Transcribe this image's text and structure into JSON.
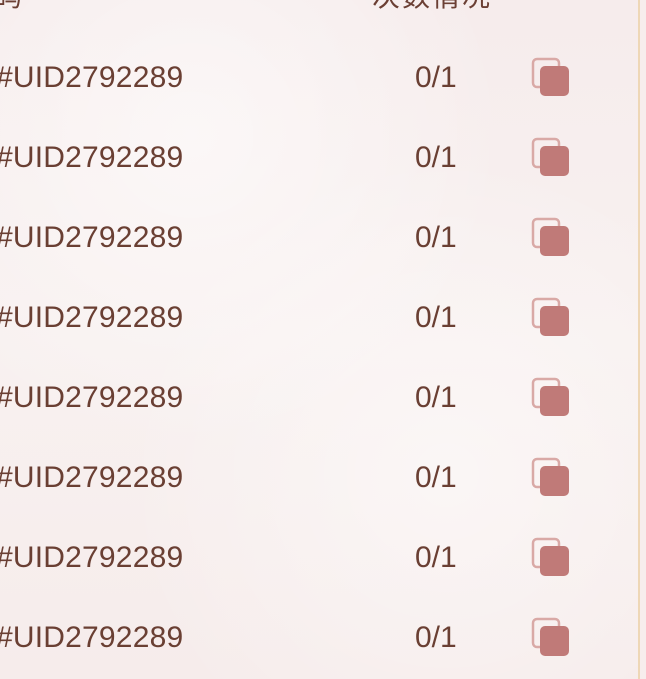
{
  "header": {
    "col_left": "码",
    "col_mid": "次数情况"
  },
  "rows": [
    {
      "uid": "#UID2792289",
      "count": "0/1"
    },
    {
      "uid": "#UID2792289",
      "count": "0/1"
    },
    {
      "uid": "#UID2792289",
      "count": "0/1"
    },
    {
      "uid": "#UID2792289",
      "count": "0/1"
    },
    {
      "uid": "#UID2792289",
      "count": "0/1"
    },
    {
      "uid": "#UID2792289",
      "count": "0/1"
    },
    {
      "uid": "#UID2792289",
      "count": "0/1"
    },
    {
      "uid": "#UID2792289",
      "count": "0/1"
    }
  ],
  "icons": {
    "copy": "copy-icon"
  },
  "colors": {
    "text": "#6a3f33",
    "icon": "#c07a78",
    "icon_outline": "#d9a9a6",
    "border": "#eed7b6"
  }
}
